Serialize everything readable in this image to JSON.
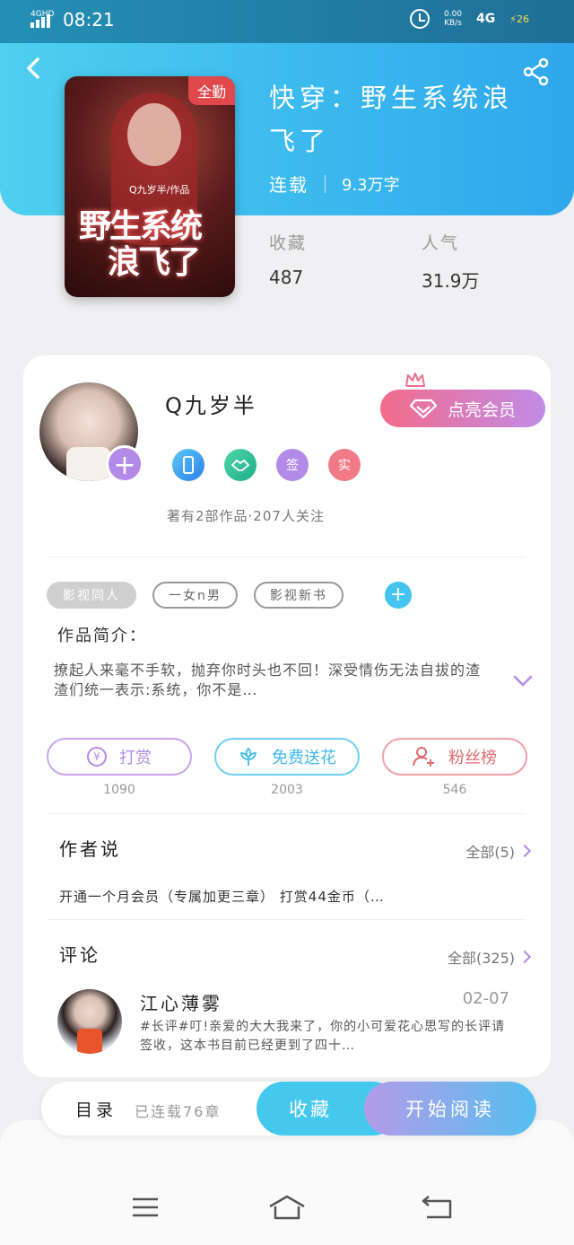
{
  "status_bar": {
    "network": "4GHD",
    "time": "08:21",
    "speed_value": "0.00",
    "speed_unit": "KB/s",
    "cellular": "4G",
    "battery": "26"
  },
  "book": {
    "cover_badge": "全勤",
    "cover_author": "Q九岁半/作品",
    "cover_title_line1": "野生系统",
    "cover_title_line2": "浪飞了",
    "title": "快穿：野生系统浪飞了",
    "status": "连载",
    "word_count": "9.3万字",
    "favorites_label": "收藏",
    "favorites_value": "487",
    "popularity_label": "人气",
    "popularity_value": "31.9万"
  },
  "author": {
    "name": "Q九岁半",
    "vip_button": "点亮会员",
    "medal_sign": "签",
    "medal_real": "实",
    "meta": "著有2部作品·207人关注"
  },
  "tags": [
    "影视同人",
    "一女n男",
    "影视新书"
  ],
  "intro": {
    "title": "作品简介：",
    "text": "撩起人来毫不手软，抛弃你时头也不回！深受情伤无法自拔的渣渣们统一表示:系统，你不是…"
  },
  "actions": {
    "tip_label": "打赏",
    "tip_count": "1090",
    "flower_label": "免费送花",
    "flower_count": "2003",
    "fans_label": "粉丝榜",
    "fans_count": "546"
  },
  "author_say": {
    "title": "作者说",
    "more": "全部(5)",
    "text": "开通一个月会员（专属加更三章） 打赏44金币（…"
  },
  "comments": {
    "title": "评论",
    "more": "全部(325)",
    "items": [
      {
        "name": "江心薄雾",
        "date": "02-07",
        "text": "#长评#叮!亲爱的大大我来了，你的小可爱花心思写的长评请签收，这本书目前已经更到了四十…"
      }
    ]
  },
  "bottom_bar": {
    "toc_label": "目录",
    "toc_sub": "已连载76章",
    "favorite_button": "收藏",
    "read_button": "开始阅读"
  },
  "colors": {
    "header_start": "#4fd0ee",
    "header_end": "#2fa8ec",
    "accent_purple": "#b48ae8",
    "accent_blue": "#45c8ee",
    "accent_pink": "#f26c8a",
    "tip_color": "#b48ae8",
    "flower_color": "#45c4f0",
    "fans_color": "#e06a70"
  }
}
